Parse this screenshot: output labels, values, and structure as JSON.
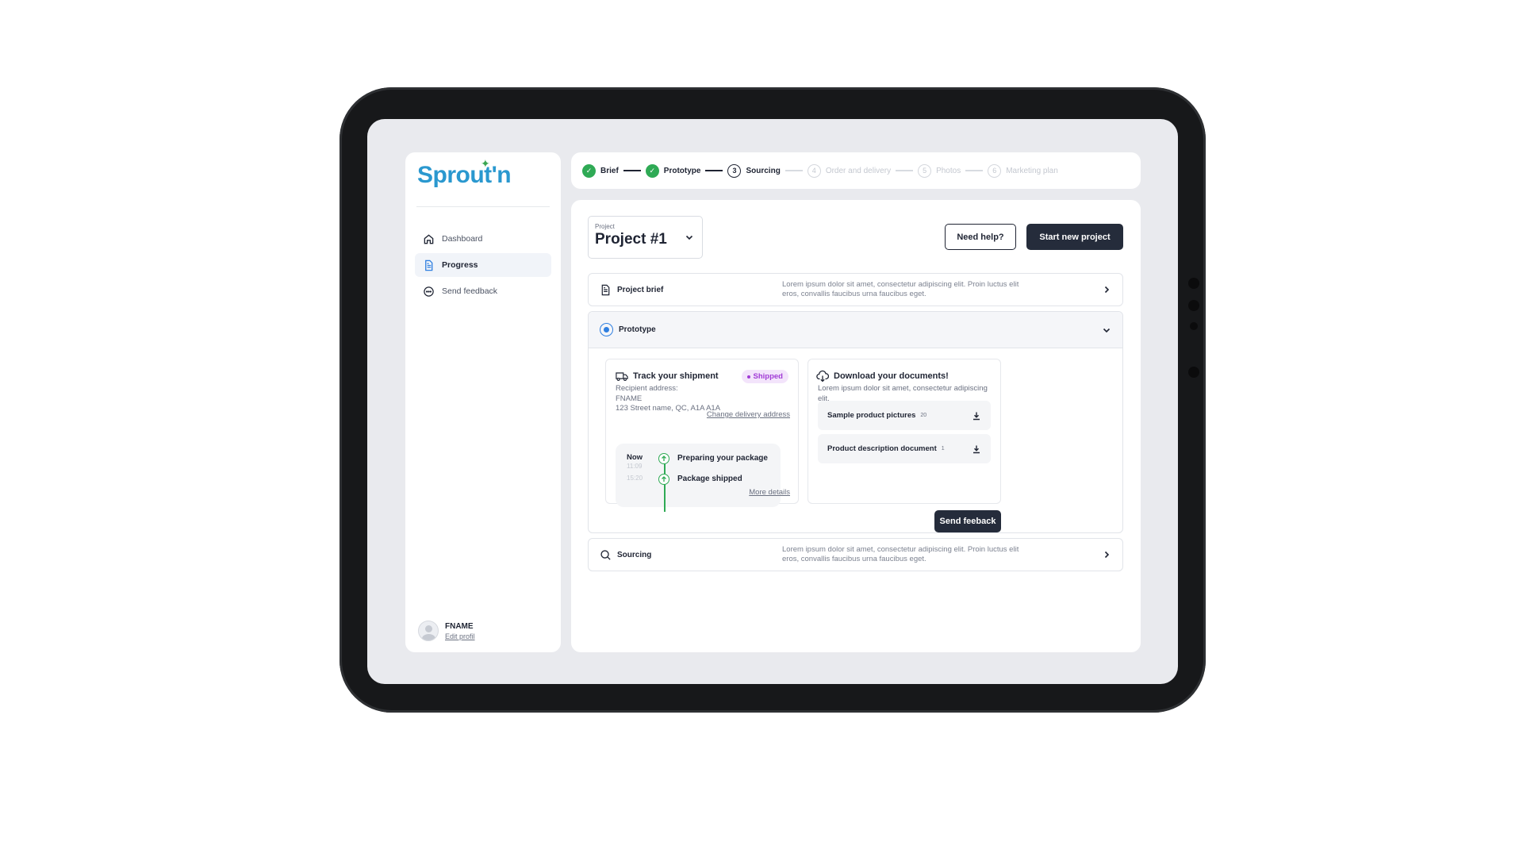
{
  "brand": {
    "name": "Sprout'n",
    "accent": "#2a98cf",
    "leaf_color": "#3aa651"
  },
  "sidebar": {
    "items": [
      {
        "label": "Dashboard",
        "icon": "home-icon",
        "active": false
      },
      {
        "label": "Progress",
        "icon": "document-icon",
        "active": true
      },
      {
        "label": "Send feedback",
        "icon": "chat-bubble-icon",
        "active": false
      }
    ],
    "profile": {
      "name": "FNAME",
      "edit_label": "Edit profil"
    }
  },
  "steps": [
    {
      "number": "1",
      "label": "Brief",
      "state": "done"
    },
    {
      "number": "2",
      "label": "Prototype",
      "state": "done"
    },
    {
      "number": "3",
      "label": "Sourcing",
      "state": "current"
    },
    {
      "number": "4",
      "label": "Order and delivery",
      "state": "todo"
    },
    {
      "number": "5",
      "label": "Photos",
      "state": "todo"
    },
    {
      "number": "6",
      "label": "Marketing plan",
      "state": "todo"
    }
  ],
  "project": {
    "select_label": "Project",
    "name": "Project #1"
  },
  "actions": {
    "help_label": "Need help?",
    "new_project_label": "Start new project"
  },
  "sections": {
    "brief": {
      "title": "Project brief",
      "desc": "Lorem ipsum dolor sit amet, consectetur adipiscing elit. Proin luctus elit eros, convallis faucibus urna faucibus eget."
    },
    "prototype": {
      "title": "Prototype"
    },
    "sourcing": {
      "title": "Sourcing",
      "desc": "Lorem ipsum dolor sit amet, consectetur adipiscing elit. Proin luctus elit eros, convallis faucibus urna faucibus eget."
    }
  },
  "shipment": {
    "title": "Track your shipment",
    "status": "Shipped",
    "recipient_label": "Recipient address:",
    "recipient_name": "FNAME",
    "address": "123 Street name, QC, A1A A1A",
    "change_label": "Change delivery address",
    "events": [
      {
        "time": "Now",
        "subtime": "11:09",
        "label": "Preparing your package"
      },
      {
        "time": "",
        "subtime": "15:20",
        "label": "Package shipped"
      }
    ],
    "more_label": "More details"
  },
  "documents": {
    "title": "Download your documents!",
    "desc": "Lorem ipsum dolor sit amet, consectetur adipiscing elit.",
    "items": [
      {
        "name": "Sample product pictures",
        "count": "20"
      },
      {
        "name": "Product description document",
        "count": "1"
      }
    ]
  },
  "feedback_button": "Send feeback",
  "colors": {
    "dark": "#252c3b",
    "success": "#2faa55",
    "badge_text": "#a13bd6",
    "badge_bg": "#f3e4fb",
    "radio": "#2f7fe0"
  }
}
